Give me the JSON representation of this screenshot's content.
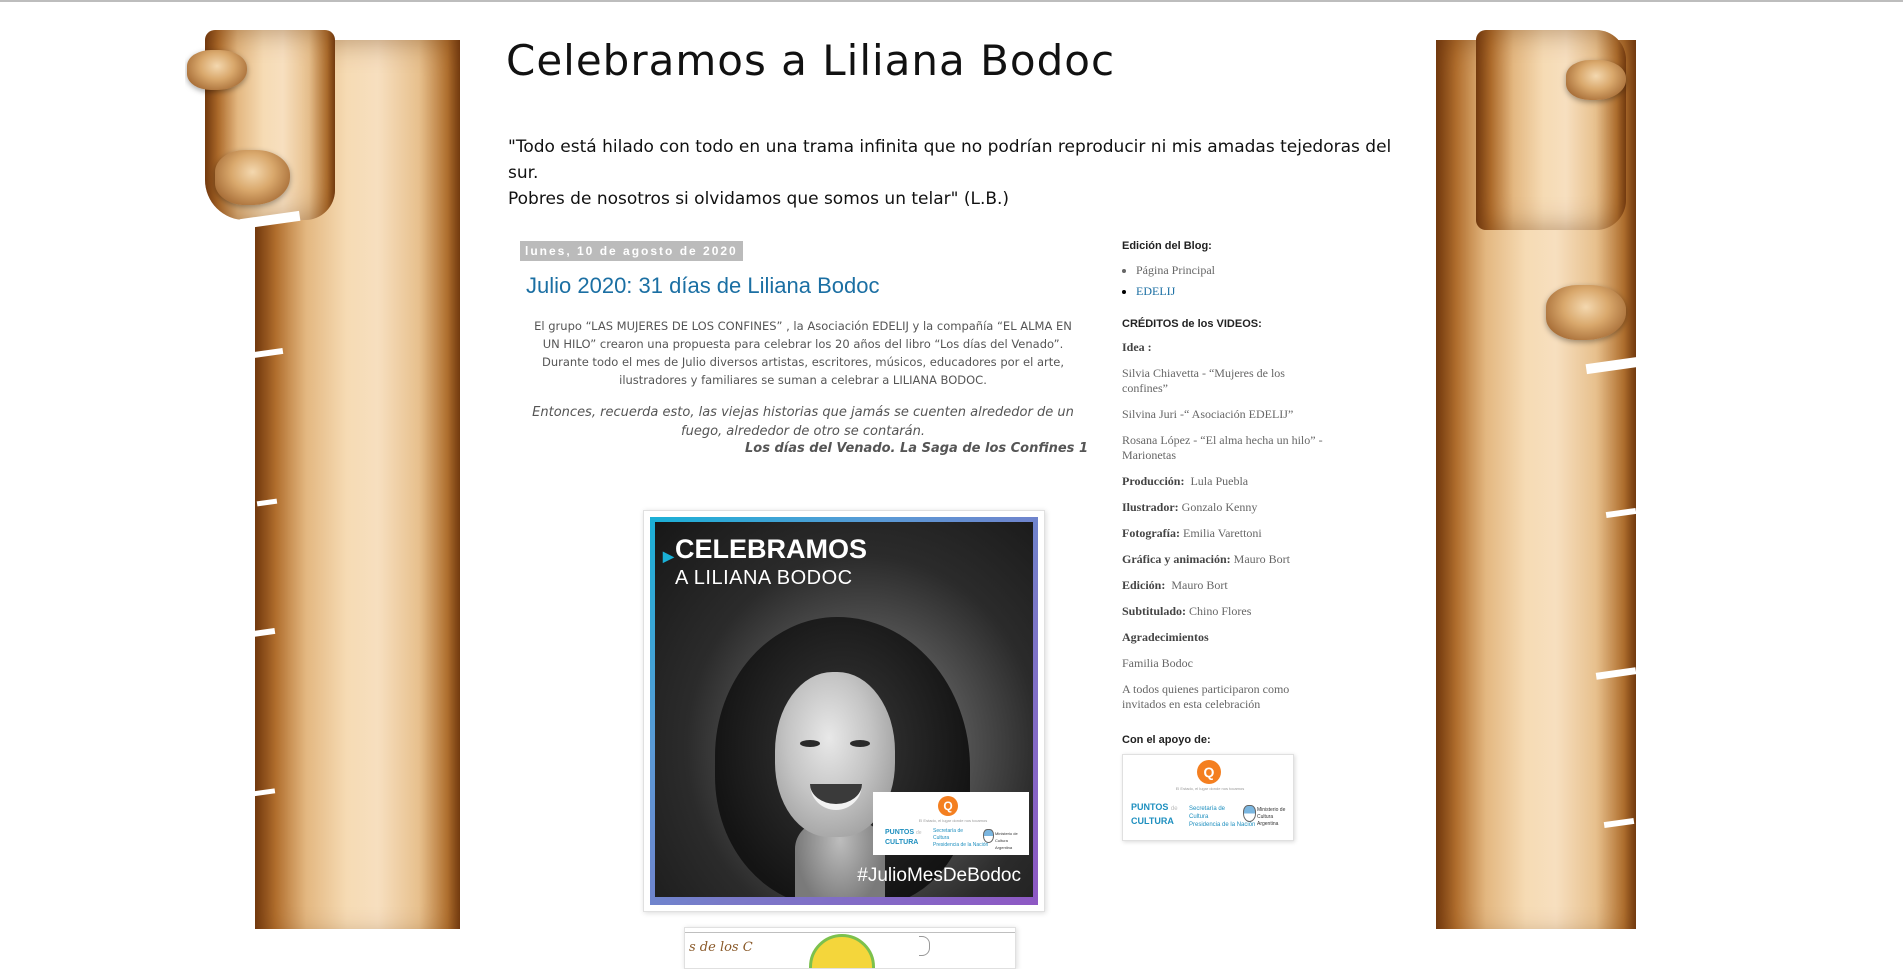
{
  "blog": {
    "title": "Celebramos a Liliana Bodoc",
    "description_line1": "\"Todo está hilado con todo en una trama infinita que no podrían reproducir ni mis amadas tejedoras del sur.",
    "description_line2": "Pobres de nosotros si olvidamos que somos un telar\" (L.B.)"
  },
  "post": {
    "date": "lunes, 10 de agosto de 2020",
    "title": "Julio 2020: 31 días de Liliana Bodoc",
    "body": "El grupo “LAS MUJERES DE LOS CONFINES” , la Asociación EDELIJ y la compañía “EL ALMA EN UN HILO” crearon una propuesta para celebrar los 20 años del libro “Los días del Venado”. Durante todo el mes de Julio diversos artistas, escritores, músicos, educadores por el arte, ilustradores y familiares se suman a celebrar a LILIANA BODOC.",
    "quote": "Entonces, recuerda esto, las viejas historias que jamás se cuenten alrededor de un fuego, alrededor de otro se contarán.",
    "quote_source": "Los días del Venado. La Saga de los Confines 1",
    "poster": {
      "heading": "CELEBRAMOS",
      "subheading": "A LILIANA BODOC",
      "hashtag": "#JulioMesDeBodoc",
      "logo_tagline": "El Estado, el lugar donde nos tocamos",
      "puntos_label_1": "PUNTOS",
      "puntos_label_2": "CULTURA",
      "puntos_de": "de",
      "secretaria_1": "Secretaría de",
      "secretaria_2": "Cultura",
      "secretaria_3": "Presidencia de la Nación",
      "ministerio_1": "Ministerio de Cultura",
      "ministerio_2": "Argentina"
    },
    "second_image_text": "s de los C"
  },
  "sidebar": {
    "edition": {
      "title": "Edición del Blog:",
      "items": [
        "Página Principal",
        "EDELIJ"
      ]
    },
    "credits": {
      "title": "CRÉDITOS de los VIDEOS:",
      "idea_label": "Idea :",
      "idea_1": "Silvia Chiavetta - “Mujeres de los confines”",
      "idea_2": "Silvina Juri -“ Asociación EDELIJ”",
      "idea_3": "Rosana López - “El alma hecha un hilo” - Marionetas",
      "produccion_label": "Producción:",
      "produccion_value": "Lula Puebla",
      "ilustrador_label": "Ilustrador:",
      "ilustrador_value": "Gonzalo Kenny",
      "fotografia_label": "Fotografía:",
      "fotografia_value": "Emilia Varettoni",
      "grafica_label": "Gráfica y animación:",
      "grafica_value": "Mauro Bort",
      "edicion_label": "Edición:",
      "edicion_value": "Mauro Bort",
      "subtitulado_label": "Subtitulado:",
      "subtitulado_value": "Chino Flores",
      "agradecimientos_label": "Agradecimientos",
      "agradecimientos_1": "Familia Bodoc",
      "agradecimientos_2": "A todos quienes participaron como invitados en esta celebración"
    },
    "apoyo": {
      "title": "Con el apoyo de:"
    }
  },
  "colors": {
    "link": "#1b6fa3",
    "date_bg": "#bbbbbb",
    "poster_accent": "#1ab0d6",
    "poster_purple": "#8e58c4",
    "logo_orange": "#f47f20"
  }
}
